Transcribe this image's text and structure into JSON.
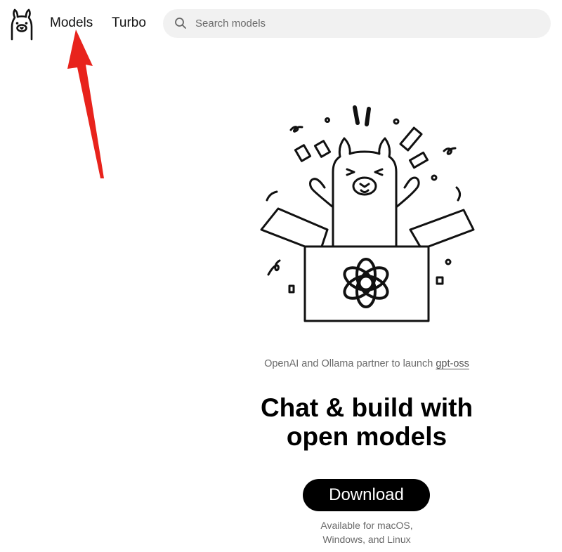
{
  "header": {
    "logo_icon": "ollama-llama-logo",
    "nav": [
      {
        "label": "Models"
      },
      {
        "label": "Turbo"
      }
    ],
    "search": {
      "icon": "search-icon",
      "placeholder": "Search models",
      "value": ""
    }
  },
  "annotation": {
    "icon": "red-arrow",
    "color": "#e8231c"
  },
  "hero": {
    "illustration_icon": "llama-in-box-with-openai-logo",
    "announcement_prefix": "OpenAI and Ollama partner to launch",
    "announcement_link": "gpt-oss",
    "headline_line1": "Chat & build with",
    "headline_line2": "open models",
    "download_label": "Download",
    "availability_line1": "Available for macOS,",
    "availability_line2": "Windows, and Linux"
  }
}
